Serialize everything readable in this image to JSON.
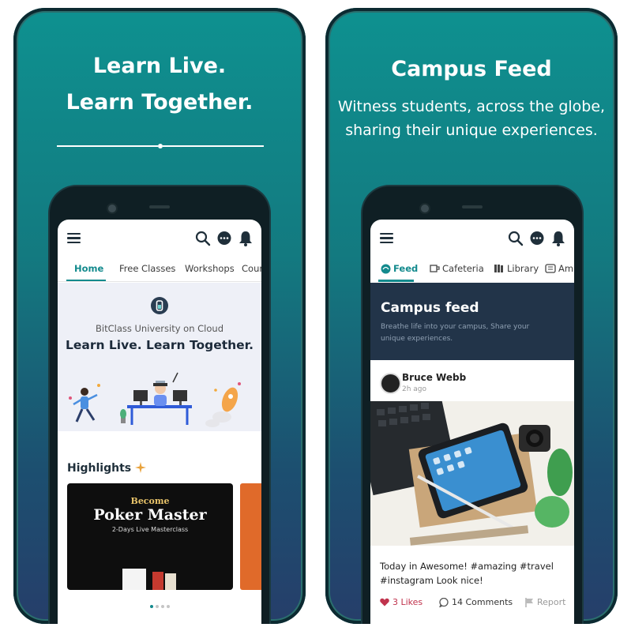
{
  "left": {
    "hero": {
      "line1": "Learn Live.",
      "line2": "Learn Together."
    },
    "tabs": [
      "Home",
      "Free Classes",
      "Workshops",
      "Cour"
    ],
    "banner": {
      "university": "BitClass University on Cloud",
      "tagline": "Learn Live. Learn Together."
    },
    "highlights_label": "Highlights",
    "poker": {
      "become": "Become",
      "title": "Poker Master",
      "subtitle": "2-Days Live Masterclass"
    }
  },
  "right": {
    "hero": {
      "title": "Campus Feed",
      "line1": "Witness students, across the globe,",
      "line2": "sharing their unique experiences."
    },
    "tabs": [
      "Feed",
      "Cafeteria",
      "Library",
      "Am"
    ],
    "banner": {
      "title": "Campus feed",
      "subtitle": "Breathe life into your campus, Share your unique experiences."
    },
    "post": {
      "author": "Bruce Webb",
      "time": "2h ago",
      "caption": "Today in Awesome! #amazing #travel #instagram Look nice!",
      "likes": "3 Likes",
      "comments": "14 Comments",
      "report": "Report"
    }
  },
  "colors": {
    "accent": "#138a8d",
    "panel_top": "#0e9190",
    "panel_bottom": "#263e6a",
    "like": "#c0334d"
  },
  "icons": [
    "menu-icon",
    "search-icon",
    "chat-icon",
    "bell-icon",
    "feed-icon",
    "cafeteria-icon",
    "library-icon",
    "heart-icon",
    "comment-icon",
    "flag-icon"
  ]
}
